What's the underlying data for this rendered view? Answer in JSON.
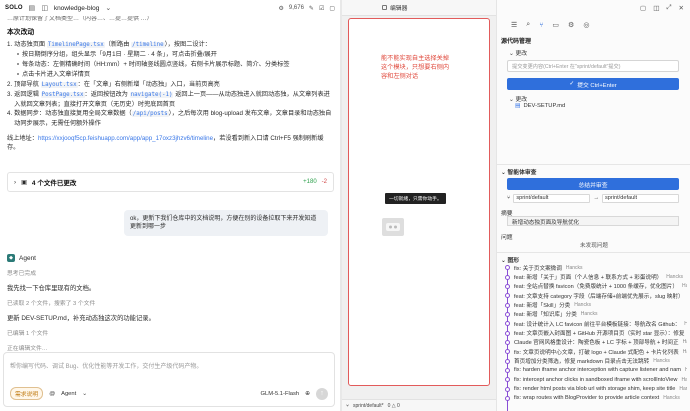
{
  "topbar": {
    "brand": "SOLO",
    "repo_name": "knowledge-blog",
    "counter": "9,676"
  },
  "chat": {
    "cut_line": "…原计划保留了文档类型…（内容…、…提…提供 …）",
    "section_title": "本次改动",
    "items": [
      {
        "num": "1.",
        "pre": "动态独页面 ",
        "code": "TimelinePage.tsx",
        "mid": "（新路由 ",
        "code2": "/timeline",
        "post": "），按图二设计："
      }
    ],
    "subitems": [
      "按日期倒序分组，组头显示「9月1日 · 星期二 · 4 条」，可点击折叠/展开",
      "每条动态：左侧精确时间（HH:mm）+ 时间轴竖线圆点竖线，右侧卡片展示标题、简介、分类标签",
      "点击卡片进入文章详情页"
    ],
    "item2": {
      "num": "2.",
      "pre": "顶部导航 ",
      "code": "Layout.tsx",
      "post": "：在「文章」右侧新增「动态独」入口，当前页高亮"
    },
    "item3": {
      "num": "3.",
      "pre": "返回逻辑 ",
      "code": "PostPage.tsx",
      "mid": "：返回按钮改为 ",
      "code2": "navigate(-1)",
      "post": " 返回上一页——从动态独进入就回动态独，从文章列表进入就回文章列表；直接打开文章页（无历史）时兜底回首页"
    },
    "item4": {
      "num": "4.",
      "pre": "数据同步：动态独直接复用全局文章数据（",
      "code": "/api/posts",
      "post": "），之后每次用 blog-upload 发布文章，文章目录和动态独自动同步展示，无需任何额外操作"
    },
    "online_prefix": "线上地址：",
    "online_link": "https://xxjooqf5cp.feishuapp.com/app/app_17oxz3jhzv6/timeline",
    "online_suffix": "，若没看到新入口请 Ctrl+F5 强制刷新缓存。",
    "changed_title": "4 个文件已更改",
    "changed_add": "+180",
    "changed_del": "-2",
    "user_message": "ok，更新下我们仓库中的文档说明，方便在别的设备拉取下来开发知道更新到哪一步",
    "agent_name": "Agent",
    "meta1": "思考已完成",
    "agent_text1": "我先找一下仓库里现有的文档。",
    "meta2": "已读取 2 个文件，搜索了 3 个文件",
    "agent_text2": "更新 DEV-SETUP.md，补充动态独这次的功能记录。",
    "meta3": "已编辑 1 个文件",
    "meta4": "正在编辑文件…"
  },
  "composer": {
    "placeholder": "帮你编写代码、调试 Bug、优化性能等开发工作，交付生产级代码产物。",
    "mode_pill": "需求说明",
    "agent_label": "Agent",
    "model": "GLM-5.1-Flash"
  },
  "preview": {
    "tab_label": "编辑器",
    "annotation": "能不能实现自主选择关掉这个模块，只想要右侧内容和左侧对话",
    "toast": "一切就绪，只需你动手。",
    "status_branch": "sprint/default*",
    "status_counts": "0 △ 0"
  },
  "source_control": {
    "title": "源代码管理",
    "changes_label": "更改",
    "message_placeholder": "提交变更内容(Ctrl+Enter 在\"sprint/default\"提交)",
    "commit_button": "提交 Ctrl+Enter",
    "changes_group": "更改",
    "file_name": "DEV-SETUP.md",
    "file_status": "M",
    "review_title": "智能体审查",
    "merge_button": "总结并审查",
    "branch_from": "sprint/default",
    "branch_to": "sprint/default",
    "summary_label": "摘要",
    "summary_text": "新增动态独页面及导航优化",
    "issues_label": "问题",
    "issues_empty": "未发现问题",
    "graph_label": "图形"
  },
  "commits": [
    {
      "msg": "fix: 关于页文案微调",
      "author": "Hancks"
    },
    {
      "msg": "feat: 新增「关于」页面（个人信息 + 联系方式 + 彩蛋说明）",
      "author": "Hancks"
    },
    {
      "msg": "feat: 全站点替换 favicon（免费版统计 + 1000 条缓存，优化图片）",
      "author": "Hancks"
    },
    {
      "msg": "feat: 文章支持 category 字段（后端存储+前端优先展示，slug 映射）",
      "author": "Hancks"
    },
    {
      "msg": "feat: 新增「Skill」分类",
      "author": "Hancks"
    },
    {
      "msg": "feat: 新增「知识库」分类",
      "author": "Hancks"
    },
    {
      "msg": "feat: 设计统计入 LC favicon 前往平台模板链接：导航改名 Github：",
      "author": "Hancks"
    },
    {
      "msg": "feat: 文章页嵌入封面图 + GitHub 开源项目页（实时 star 显示）：修复",
      "author": "Hancks"
    },
    {
      "msg": "Claude 官网风格重设计：陶瓷色板 + LC 字标 + 顶部导航 + 时间正",
      "author": "Hancks"
    },
    {
      "msg": "fix: 文章页说明中心文章，打破 logo + Claude 式配色 + 卡片化列表",
      "author": "Hancks"
    },
    {
      "msg": "首页增加分类筛选，修复 markdown 目录点击无法跳转",
      "author": "Hancks"
    },
    {
      "msg": "fix: harden iframe anchor interception with capture listener and nam",
      "author": "Hancks"
    },
    {
      "msg": "fix: intercept anchor clicks in sandboxed iframe with scrollIntoView",
      "author": "Hancks"
    },
    {
      "msg": "fix: render html posts via blob url with storage shim, keep site title",
      "author": "Hancks"
    },
    {
      "msg": "fix: wrap routes with BlogProvider to provide article context",
      "author": "Hancks"
    }
  ]
}
